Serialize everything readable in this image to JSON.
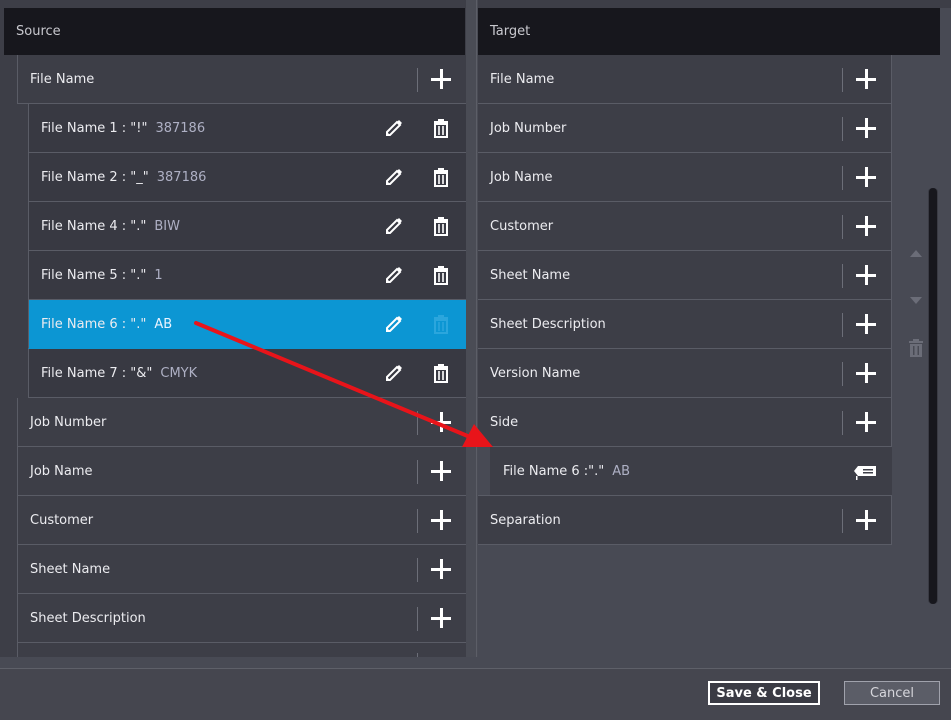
{
  "source": {
    "header": "Source",
    "group_label": "File Name",
    "children": [
      {
        "label": "File Name 1 : \"!\"",
        "value": "387186"
      },
      {
        "label": "File Name 2 : \"_\"",
        "value": "387186"
      },
      {
        "label": "File Name 4 : \".\"",
        "value": "BIW"
      },
      {
        "label": "File Name 5 : \".\"",
        "value": "1"
      },
      {
        "label": "File Name 6 : \".\"",
        "value": "AB",
        "selected": true
      },
      {
        "label": "File Name 7 : \"&\"",
        "value": "CMYK"
      }
    ],
    "items": [
      "Job Number",
      "Job Name",
      "Customer",
      "Sheet Name",
      "Sheet Description"
    ]
  },
  "target": {
    "header": "Target",
    "items": [
      "File Name",
      "Job Number",
      "Job Name",
      "Customer",
      "Sheet Name",
      "Sheet Description",
      "Version Name",
      "Side"
    ],
    "mapped": {
      "label": "File Name 6 :\".\"",
      "value": "AB"
    },
    "after": [
      "Separation"
    ]
  },
  "footer": {
    "save_label": "Save & Close",
    "cancel_label": "Cancel"
  },
  "icons": {
    "add": "plus-icon",
    "edit": "pencil-icon",
    "delete": "trash-icon",
    "tag": "tag-icon",
    "move_up": "arrow-up-icon",
    "move_down": "arrow-down-icon"
  },
  "colors": {
    "selected": "#0c96d3",
    "annotation_arrow": "#e8141a",
    "header_bg": "#17171d"
  }
}
